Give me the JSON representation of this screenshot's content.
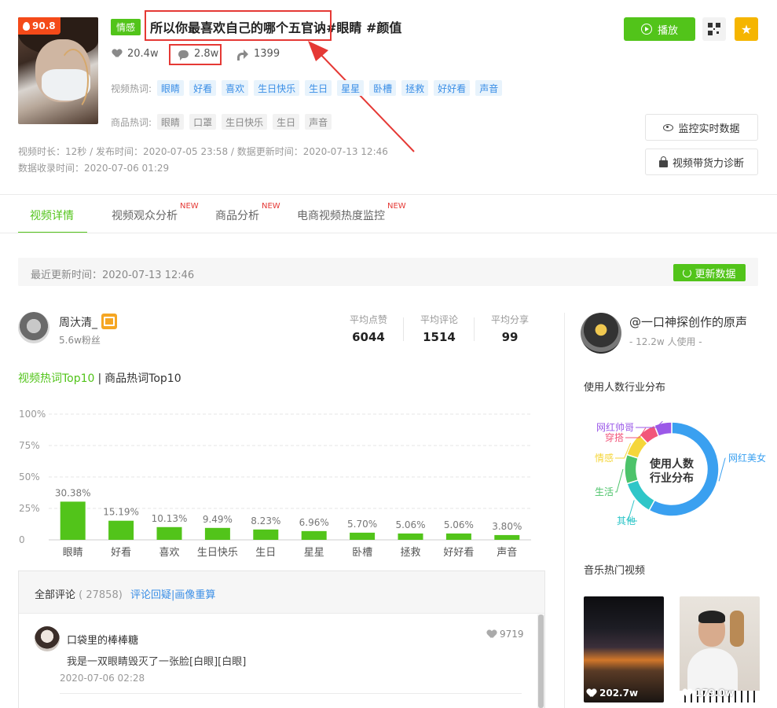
{
  "video": {
    "heat_score": "90.8",
    "category": "情感",
    "title": "所以你最喜欢自己的哪个五官讷#眼睛 #颜值",
    "likes": "20.4w",
    "comments": "2.8w",
    "shares": "1399",
    "hot_words_label": "视频热词:",
    "hot_words": [
      "眼睛",
      "好看",
      "喜欢",
      "生日快乐",
      "生日",
      "星星",
      "卧槽",
      "拯救",
      "好好看",
      "声音"
    ],
    "product_words_label": "商品热词:",
    "product_words": [
      "眼睛",
      "口罩",
      "生日快乐",
      "生日",
      "声音"
    ],
    "meta_line1": "视频时长：12秒 / 发布时间：2020-07-05 23:58 / 数据更新时间：2020-07-13 12:46",
    "meta_line2": "数据收录时间：2020-07-06 01:29"
  },
  "actions": {
    "play": "播放",
    "monitor": "监控实时数据",
    "diagnose": "视频带货力诊断"
  },
  "tabs": [
    {
      "label": "视频详情",
      "new": ""
    },
    {
      "label": "视频观众分析",
      "new": "NEW"
    },
    {
      "label": "商品分析",
      "new": "NEW"
    },
    {
      "label": "电商视频热度监控",
      "new": "NEW"
    }
  ],
  "update": {
    "text": "最近更新时间：2020-07-13 12:46",
    "button": "更新数据"
  },
  "author": {
    "name": "周汏清_",
    "fans": "5.6w粉丝",
    "avg_likes_label": "平均点赞",
    "avg_likes": "6044",
    "avg_comments_label": "平均评论",
    "avg_comments": "1514",
    "avg_shares_label": "平均分享",
    "avg_shares": "99"
  },
  "hot_toggle": {
    "video": "视频热词Top10",
    "sep": "|",
    "product": "商品热词Top10"
  },
  "chart_data": {
    "type": "bar",
    "categories": [
      "眼睛",
      "好看",
      "喜欢",
      "生日快乐",
      "生日",
      "星星",
      "卧槽",
      "拯救",
      "好好看",
      "声音"
    ],
    "values": [
      30.38,
      15.19,
      10.13,
      9.49,
      8.23,
      6.96,
      5.7,
      5.06,
      5.06,
      3.8
    ],
    "value_labels": [
      "30.38%",
      "15.19%",
      "10.13%",
      "9.49%",
      "8.23%",
      "6.96%",
      "5.70%",
      "5.06%",
      "5.06%",
      "3.80%"
    ],
    "y_ticks": [
      "100%",
      "75%",
      "50%",
      "25%",
      "0"
    ],
    "ylim": [
      0,
      100
    ],
    "grid": true,
    "color": "#52c41a"
  },
  "comments": {
    "title": "全部评论",
    "count": "( 27858)",
    "links": "评论回疑|画像重算",
    "items": [
      {
        "user": "口袋里的棒棒糖",
        "likes": "9719",
        "text": "我是一双眼睛毁灭了一张脸[白眼][白眼]",
        "time": "2020-07-06 02:28"
      }
    ]
  },
  "music": {
    "title": "@一口神探创作的原声",
    "users": "- 12.2w 人使用 -",
    "distribution_title": "使用人数行业分布",
    "donut_center_line1": "使用人数",
    "donut_center_line2": "行业分布",
    "distribution": [
      {
        "name": "网红美女",
        "value": 58,
        "color": "#3aa0f0"
      },
      {
        "name": "其他",
        "value": 12,
        "color": "#2fc6c8"
      },
      {
        "name": "生活",
        "value": 10,
        "color": "#4cc36a"
      },
      {
        "name": "情感",
        "value": 8,
        "color": "#f5d63a"
      },
      {
        "name": "穿搭",
        "value": 6,
        "color": "#f2557a"
      },
      {
        "name": "网红帅哥",
        "value": 6,
        "color": "#9b59e8"
      }
    ],
    "hot_videos_title": "音乐热门视频",
    "hot_videos": [
      {
        "likes": "202.7w"
      },
      {
        "likes": "179.0w"
      }
    ]
  }
}
